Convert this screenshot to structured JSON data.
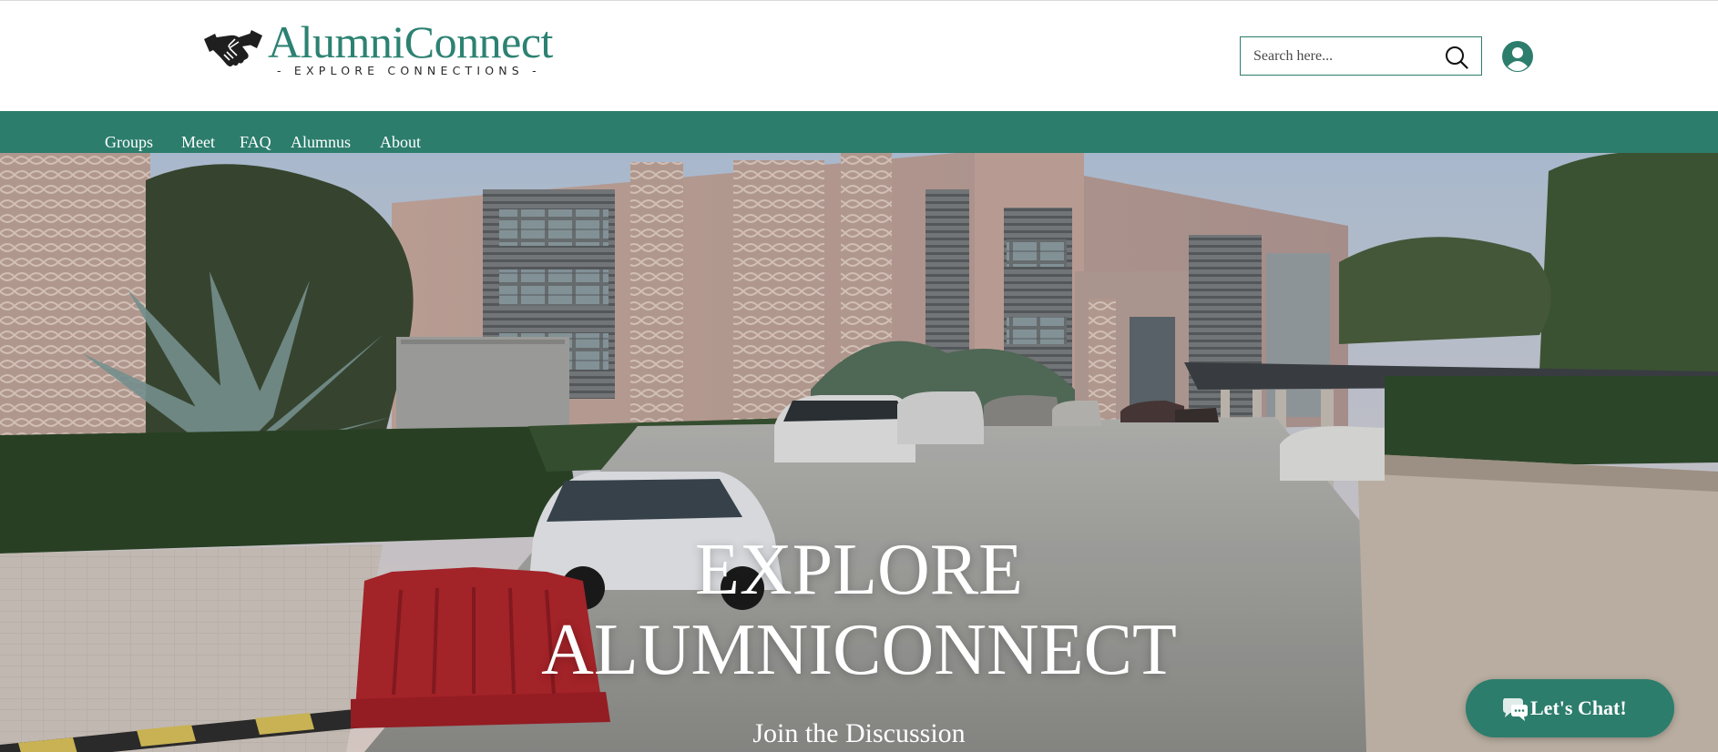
{
  "brand": {
    "name": "AlumniConnect",
    "tagline": "- EXPLORE CONNECTIONS -",
    "logo_icon": "handshake-icon",
    "color_primary": "#2c7d6c",
    "color_logo_text": "#2c8272"
  },
  "header": {
    "search": {
      "placeholder": "Search here...",
      "value": "",
      "icon": "search-icon"
    },
    "account_icon": "user-account-icon"
  },
  "nav": {
    "items": [
      {
        "label": "Groups"
      },
      {
        "label": "Meet"
      },
      {
        "label": "FAQ"
      },
      {
        "label": "Alumnus"
      },
      {
        "label": "About"
      }
    ]
  },
  "hero": {
    "title_line1": "EXPLORE",
    "title_line2": "ALUMNICONNECT",
    "subtitle": "Join the Discussion",
    "background": "campus-building-photo"
  },
  "chat": {
    "label": "Let's Chat!",
    "icon": "chat-bubbles-icon"
  }
}
